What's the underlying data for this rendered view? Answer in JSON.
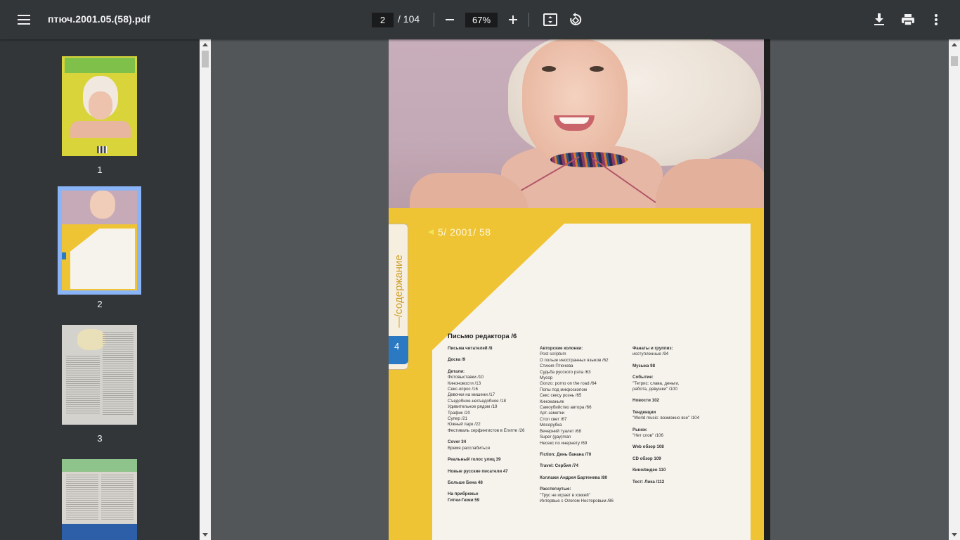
{
  "toolbar": {
    "title": "птюч.2001.05.(58).pdf",
    "current_page": "2",
    "total_pages": "/ 104",
    "zoom": "67%"
  },
  "sidebar": {
    "thumbnails": [
      {
        "label": "1"
      },
      {
        "label": "2"
      },
      {
        "label": "3"
      },
      {
        "label": ""
      }
    ]
  },
  "page": {
    "issue": "5/ 2001/ 58",
    "section": "—/содержание",
    "page_number": "4",
    "toc_title": "Письмо редактора /6",
    "col1": [
      "Письма читателей /8",
      "",
      "Доска /9",
      "",
      "Детали:",
      "Фотовыставки /10",
      "Киноновости /13",
      "Секс-опрос /16",
      "Девочки на мишени /17",
      "Съедобное-несъедобное /18",
      "Удивительное рядом /19",
      "Трафик /20",
      "Супер /21",
      "Южный парк /22",
      "Фестиваль серфингистов в Египте /26",
      "",
      "Cover 34",
      "Время расслабиться",
      "",
      "Реальный голос улиц 39",
      "",
      "Новые русские писатели 47",
      "",
      "Больше Бена 48",
      "",
      "На прибрежье",
      "Гитчи-Гюми 59"
    ],
    "col2": [
      "Авторские колонки:",
      "Post scriptum",
      "О пользе иностранных языков /62",
      "Стихия Птючева",
      "Судьба русского рэпа /63",
      "Мусор",
      "Gonzo: porno on the road /64",
      "Попы под микроскопом",
      "Секс сексу рознь /65",
      "Киноманьяк",
      "Самоубийство автора /66",
      "Арт-заметки",
      "Стоп свет /67",
      "Мясорубка",
      "Вечерний туалет /68",
      "Super (gay)man",
      "Несекс по инернету /69",
      "",
      "Fiction: День банана /70",
      "",
      "Travel: Сербия /74",
      "",
      "Коллажи Андрея Бартенева /80",
      "",
      "Расстегнутые:",
      "\"Трус не играет в хоккей\"",
      "Интервью с Олегом Нестеровым /86"
    ],
    "col3": [
      "Фанаты и группиз:",
      "исступленные /94",
      "",
      "Музыка 98",
      "",
      "Событие:",
      "\"Тетрис: слава, деньги,",
      "работа, девушки\" /100",
      "",
      "Новости 102",
      "",
      "Тенденции",
      "\"World music: возможно все\" /104",
      "",
      "Рынок",
      "\"Нет слов\" /106",
      "",
      "Web обзор 108",
      "",
      "CD обзор 109",
      "",
      "Кино/видео 110",
      "",
      "Тест: Лика /112"
    ]
  },
  "colors": {
    "toolbar_bg": "#323639",
    "viewer_bg": "#525659",
    "selected_outline": "#8ab4f8",
    "page_yellow": "#efc434"
  },
  "icons": {
    "menu": "menu-icon",
    "zoom_out": "minus-icon",
    "zoom_in": "plus-icon",
    "fit": "fit-page-icon",
    "rotate": "rotate-icon",
    "download": "download-icon",
    "print": "print-icon",
    "more": "more-vert-icon"
  }
}
